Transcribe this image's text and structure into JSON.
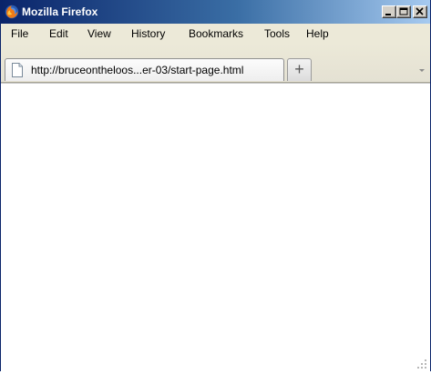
{
  "window": {
    "title": "Mozilla Firefox"
  },
  "menu": {
    "items": [
      {
        "label": "File"
      },
      {
        "label": "Edit"
      },
      {
        "label": "View"
      },
      {
        "label": "History"
      },
      {
        "label": "Bookmarks"
      },
      {
        "label": "Tools"
      },
      {
        "label": "Help"
      }
    ]
  },
  "tabs": [
    {
      "title": "http://bruceontheloos...er-03/start-page.html",
      "icon": "page-icon",
      "active": true
    }
  ],
  "new_tab": {
    "label": "+"
  },
  "colors": {
    "titlebar_start": "#0a246a",
    "titlebar_end": "#a6caf0",
    "chrome_bg": "#ece9d8",
    "content_bg": "#ffffff"
  }
}
